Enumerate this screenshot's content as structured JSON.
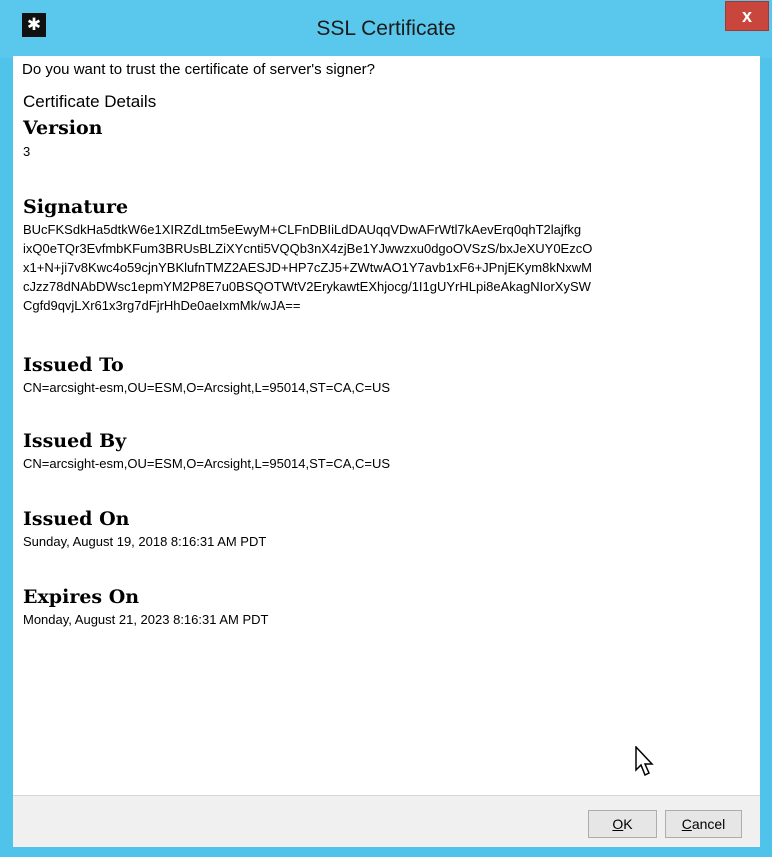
{
  "window": {
    "title": "SSL Certificate",
    "close_glyph": "x",
    "app_icon": "tool-icon"
  },
  "question": "Do you want to trust the certificate of server's signer?",
  "details_title": "Certificate Details",
  "sections": {
    "version": {
      "label": "Version",
      "value": "3"
    },
    "signature": {
      "label": "Signature",
      "lines": [
        "BUcFKSdkHa5dtkW6e1XIRZdLtm5eEwyM+CLFnDBIiLdDAUqqVDwAFrWtl7kAevErq0qhT2lajfkg",
        "ixQ0eTQr3EvfmbKFum3BRUsBLZiXYcnti5VQQb3nX4zjBe1YJwwzxu0dgoOVSzS/bxJeXUY0EzcO",
        "x1+N+ji7v8Kwc4o59cjnYBKlufnTMZ2AESJD+HP7cZJ5+ZWtwAO1Y7avb1xF6+JPnjEKym8kNxwM",
        "cJzz78dNAbDWsc1epmYM2P8E7u0BSQOTWtV2ErykawtEXhjocg/1I1gUYrHLpi8eAkagNIorXySW",
        "Cgfd9qvjLXr61x3rg7dFjrHhDe0aeIxmMk/wJA=="
      ]
    },
    "issued_to": {
      "label": "Issued To",
      "value": "CN=arcsight-esm,OU=ESM,O=Arcsight,L=95014,ST=CA,C=US"
    },
    "issued_by": {
      "label": "Issued By",
      "value": "CN=arcsight-esm,OU=ESM,O=Arcsight,L=95014,ST=CA,C=US"
    },
    "issued_on": {
      "label": "Issued On",
      "value": "Sunday, August 19, 2018 8:16:31 AM PDT"
    },
    "expires_on": {
      "label": "Expires On",
      "value": "Monday, August 21, 2023 8:16:31 AM PDT"
    }
  },
  "buttons": {
    "ok_prefix": "O",
    "ok_rest": "K",
    "cancel_prefix": "C",
    "cancel_rest": "ancel"
  },
  "colors": {
    "titlebar": "#5ac8ec",
    "close": "#c9463d"
  }
}
